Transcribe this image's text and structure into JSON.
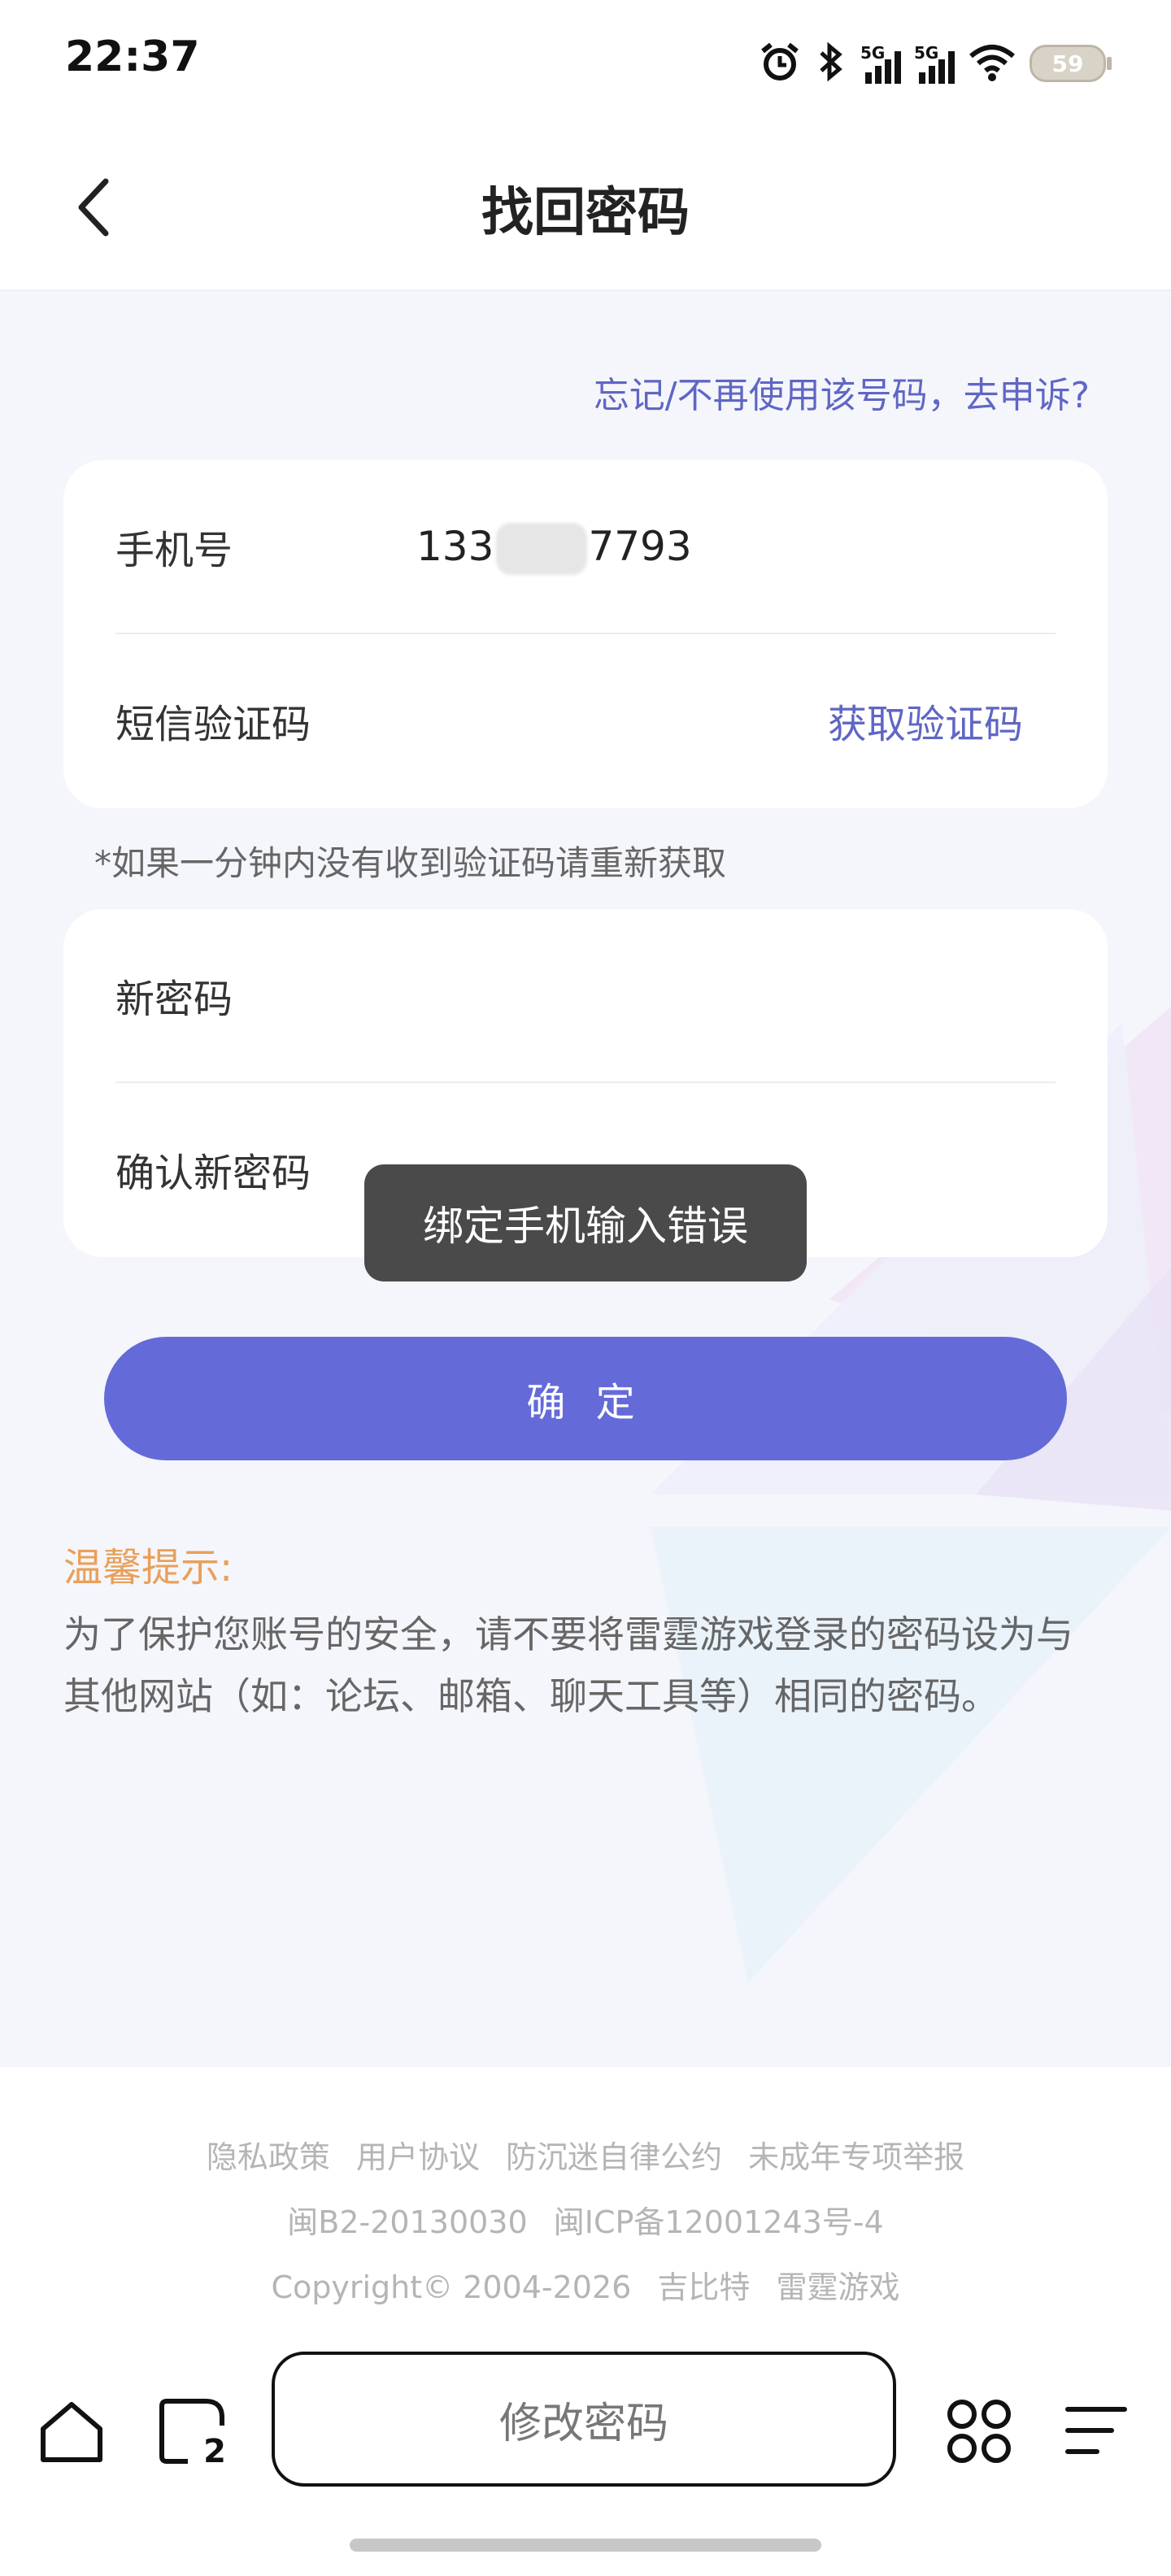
{
  "status_bar": {
    "time": "22:37",
    "network_1": "5G",
    "network_2": "5G",
    "battery": "59"
  },
  "header": {
    "title": "找回密码"
  },
  "appeal_link": "忘记/不再使用该号码，去申诉?",
  "form": {
    "phone_label": "手机号",
    "phone_prefix": "133",
    "phone_suffix": "7793",
    "sms_label": "短信验证码",
    "get_code_label": "获取验证码",
    "note": "*如果一分钟内没有收到验证码请重新获取",
    "new_password_label": "新密码",
    "confirm_password_label": "确认新密码"
  },
  "toast": "绑定手机输入错误",
  "confirm_button": "确 定",
  "tips": {
    "title": "温馨提示:",
    "body": "为了保护您账号的安全，请不要将雷霆游戏登录的密码设为与其他网站（如：论坛、邮箱、聊天工具等）相同的密码。"
  },
  "footer": {
    "links": [
      "隐私政策",
      "用户协议",
      "防沉迷自律公约",
      "未成年专项举报"
    ],
    "license_1": "闽B2-20130030",
    "license_2": "闽ICP备12001243号-4",
    "copyright": "Copyright© 2004-2026",
    "company_1": "吉比特",
    "company_2": "雷霆游戏"
  },
  "browser_bar": {
    "tab_count": "2",
    "page_title": "修改密码"
  },
  "colors": {
    "accent": "#646bd8",
    "link": "#5f66c4",
    "tip": "#e9a05a",
    "background": "#f5f6fb"
  }
}
